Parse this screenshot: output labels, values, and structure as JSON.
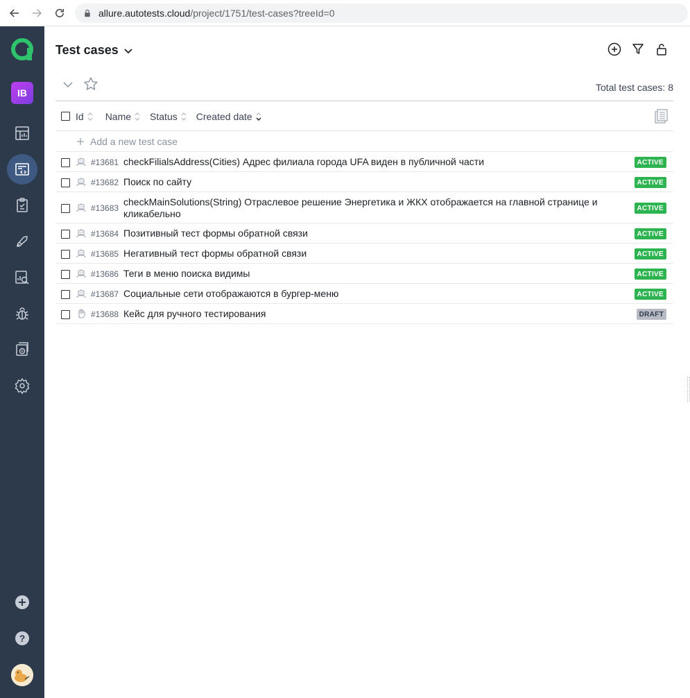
{
  "browser": {
    "url_host": "allure.autotests.cloud",
    "url_path": "/project/1751/test-cases?treeId=0"
  },
  "sidebar": {
    "workspace_initials": "IB",
    "items": [
      {
        "name": "dashboards-icon"
      },
      {
        "name": "test-cases-icon",
        "active": true
      },
      {
        "name": "test-plans-icon"
      },
      {
        "name": "launches-icon"
      },
      {
        "name": "analytics-icon"
      },
      {
        "name": "defects-icon"
      },
      {
        "name": "jobs-icon"
      },
      {
        "name": "settings-icon"
      }
    ],
    "bottom": [
      "add-circle-icon",
      "help-icon",
      "user-avatar"
    ]
  },
  "header": {
    "title": "Test cases"
  },
  "toolbar": {
    "total_label": "Total test cases: 8"
  },
  "table": {
    "columns": [
      {
        "key": "id",
        "label": "Id"
      },
      {
        "key": "name",
        "label": "Name"
      },
      {
        "key": "status",
        "label": "Status"
      },
      {
        "key": "created",
        "label": "Created date"
      }
    ],
    "add_label": "Add a new test case",
    "rows": [
      {
        "id": "#13681",
        "name": "checkFilialsAddress(Cities) Адрес филиала города UFA виден в публичной части",
        "status": "ACTIVE",
        "type": "automated"
      },
      {
        "id": "#13682",
        "name": "Поиск по сайту",
        "status": "ACTIVE",
        "type": "automated"
      },
      {
        "id": "#13683",
        "name": "checkMainSolutions(String) Отраслевое решение Энергетика и ЖКХ отображается на главной странице и кликабельно",
        "status": "ACTIVE",
        "type": "automated"
      },
      {
        "id": "#13684",
        "name": "Позитивный тест формы обратной связи",
        "status": "ACTIVE",
        "type": "automated"
      },
      {
        "id": "#13685",
        "name": "Негативный тест формы обратной связи",
        "status": "ACTIVE",
        "type": "automated"
      },
      {
        "id": "#13686",
        "name": "Теги в меню поиска видимы",
        "status": "ACTIVE",
        "type": "automated"
      },
      {
        "id": "#13687",
        "name": "Социальные сети отображаются в бургер-меню",
        "status": "ACTIVE",
        "type": "automated"
      },
      {
        "id": "#13688",
        "name": "Кейс для ручного тестирования",
        "status": "DRAFT",
        "type": "manual"
      }
    ]
  },
  "colors": {
    "sidebar_bg": "#2d3a4b",
    "active_badge": "#2db450",
    "draft_badge": "#b7bcc4",
    "logo": "#2fc36b"
  }
}
